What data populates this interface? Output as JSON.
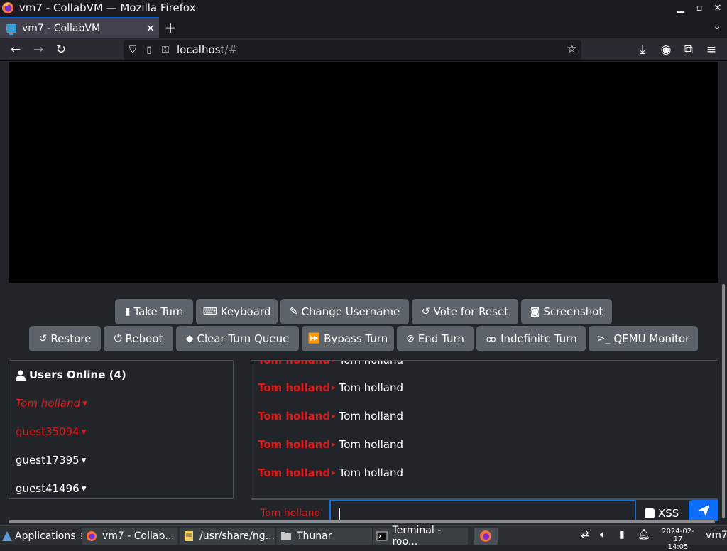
{
  "window": {
    "title": "vm7 - CollabVM — Mozilla Firefox"
  },
  "tab": {
    "title": "vm7 - CollabVM"
  },
  "url": {
    "host": "localhost",
    "path": "/#"
  },
  "buttons_row1": [
    {
      "label": "Take Turn",
      "icon": "mouse-icon"
    },
    {
      "label": "Keyboard",
      "icon": "keyboard-icon"
    },
    {
      "label": "Change Username",
      "icon": "user-edit-icon"
    },
    {
      "label": "Vote for Reset",
      "icon": "undo-icon"
    },
    {
      "label": "Screenshot",
      "icon": "camera-icon"
    }
  ],
  "buttons_row2": [
    {
      "label": "Restore",
      "icon": "restore-icon"
    },
    {
      "label": "Reboot",
      "icon": "power-icon"
    },
    {
      "label": "Clear Turn Queue",
      "icon": "eraser-icon"
    },
    {
      "label": "Bypass Turn",
      "icon": "forward-icon"
    },
    {
      "label": "End Turn",
      "icon": "ban-icon"
    },
    {
      "label": "Indefinite Turn",
      "icon": "infinity-icon"
    },
    {
      "label": "QEMU Monitor",
      "icon": "terminal-icon"
    }
  ],
  "users": {
    "header": "Users Online (4)",
    "list": [
      "Tom holland",
      "guest35094",
      "guest17395",
      "guest41496"
    ]
  },
  "chat": {
    "messages": [
      {
        "from": "Tom holland",
        "text": "Tom holland"
      },
      {
        "from": "Tom holland",
        "text": "Tom holland"
      },
      {
        "from": "Tom holland",
        "text": "Tom holland"
      },
      {
        "from": "Tom holland",
        "text": "Tom holland"
      },
      {
        "from": "Tom holland",
        "text": "Tom holland"
      }
    ],
    "username": "Tom holland",
    "input_value": "",
    "xss_label": "XSS"
  },
  "taskbar": {
    "apps_label": "Applications",
    "tasks": [
      {
        "label": "vm7 - Collab..."
      },
      {
        "label": "/usr/share/ng..."
      },
      {
        "label": "Thunar"
      },
      {
        "label": "Terminal - roo..."
      }
    ],
    "date": "2024-02-17",
    "time": "14:05",
    "user": "vm7"
  },
  "colors": {
    "accent": "#0d6efd",
    "user_red": "#e01818",
    "button_gray": "#5c636a"
  }
}
